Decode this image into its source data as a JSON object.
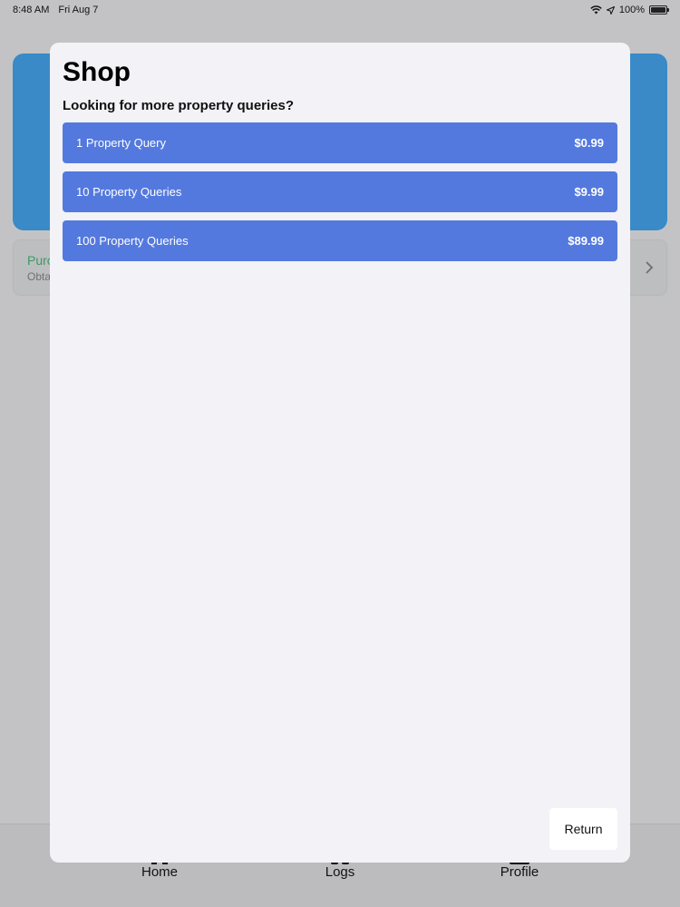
{
  "status_bar": {
    "time": "8:48 AM",
    "date": "Fri Aug 7",
    "battery": "100%",
    "icons": [
      "wifi-icon",
      "location-icon",
      "battery-icon"
    ]
  },
  "background": {
    "purchase_title": "Purc",
    "purchase_subtitle": "Obta",
    "tabs": [
      {
        "label": "Home",
        "icon": "home-icon"
      },
      {
        "label": "Logs",
        "icon": "logs-icon"
      },
      {
        "label": "Profile",
        "icon": "profile-icon"
      }
    ],
    "colors": {
      "card": "#3a8ac8",
      "purchase_title": "#3b9a66"
    }
  },
  "sheet": {
    "title": "Shop",
    "subtitle": "Looking for more property queries?",
    "products": [
      {
        "name": "1 Property Query",
        "price": "$0.99"
      },
      {
        "name": "10 Property Queries",
        "price": "$9.99"
      },
      {
        "name": "100 Property Queries",
        "price": "$89.99"
      }
    ],
    "return_label": "Return",
    "colors": {
      "product": "#5479de",
      "background": "#f2f2f7"
    }
  }
}
